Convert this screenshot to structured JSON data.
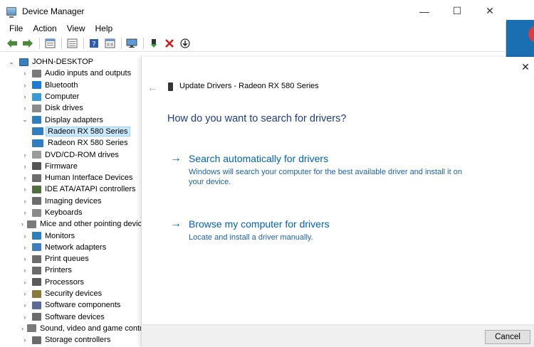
{
  "window": {
    "title": "Device Manager",
    "minimize_glyph": "—",
    "maximize_glyph": "☐",
    "close_glyph": "✕"
  },
  "menu": [
    "File",
    "Action",
    "View",
    "Help"
  ],
  "toolbar": [
    "back-icon",
    "forward-icon",
    "properties-icon",
    "console-icon",
    "help-icon",
    "view-icon",
    "monitor-icon",
    "update-driver-icon",
    "uninstall-icon",
    "download-icon"
  ],
  "tree": {
    "root": "JOHN-DESKTOP",
    "items": [
      {
        "label": "Audio inputs and outputs",
        "icon": "speaker-icon",
        "color": "#7a7a7a",
        "expanded": false
      },
      {
        "label": "Bluetooth",
        "icon": "bluetooth-icon",
        "color": "#1c7cd5",
        "expanded": false
      },
      {
        "label": "Computer",
        "icon": "computer-icon",
        "color": "#3a9ad9",
        "expanded": false
      },
      {
        "label": "Disk drives",
        "icon": "disk-icon",
        "color": "#8a8a8a",
        "expanded": false
      },
      {
        "label": "Display adapters",
        "icon": "display-icon",
        "color": "#2d7fc1",
        "expanded": true,
        "children": [
          {
            "label": "Radeon RX 580 Series",
            "selected": true
          },
          {
            "label": "Radeon RX 580 Series",
            "selected": false
          }
        ]
      },
      {
        "label": "DVD/CD-ROM drives",
        "icon": "dvd-icon",
        "color": "#9a9a9a",
        "expanded": false
      },
      {
        "label": "Firmware",
        "icon": "firmware-icon",
        "color": "#555555",
        "expanded": false
      },
      {
        "label": "Human Interface Devices",
        "icon": "hid-icon",
        "color": "#6b6b6b",
        "expanded": false
      },
      {
        "label": "IDE ATA/ATAPI controllers",
        "icon": "ide-icon",
        "color": "#4f6f3f",
        "expanded": false
      },
      {
        "label": "Imaging devices",
        "icon": "camera-icon",
        "color": "#6b6b6b",
        "expanded": false
      },
      {
        "label": "Keyboards",
        "icon": "keyboard-icon",
        "color": "#8a8a8a",
        "expanded": false
      },
      {
        "label": "Mice and other pointing devices",
        "icon": "mouse-icon",
        "color": "#7a7a7a",
        "expanded": false
      },
      {
        "label": "Monitors",
        "icon": "monitor-icon",
        "color": "#2d7fc1",
        "expanded": false
      },
      {
        "label": "Network adapters",
        "icon": "network-icon",
        "color": "#3a7fc1",
        "expanded": false
      },
      {
        "label": "Print queues",
        "icon": "print-queue-icon",
        "color": "#6b6b6b",
        "expanded": false
      },
      {
        "label": "Printers",
        "icon": "printer-icon",
        "color": "#6b6b6b",
        "expanded": false
      },
      {
        "label": "Processors",
        "icon": "processor-icon",
        "color": "#5a5a5a",
        "expanded": false
      },
      {
        "label": "Security devices",
        "icon": "security-icon",
        "color": "#8a7a3a",
        "expanded": false
      },
      {
        "label": "Software components",
        "icon": "software-component-icon",
        "color": "#5a6a9a",
        "expanded": false
      },
      {
        "label": "Software devices",
        "icon": "software-device-icon",
        "color": "#6b6b6b",
        "expanded": false
      },
      {
        "label": "Sound, video and game controllers",
        "icon": "sound-icon",
        "color": "#7a7a7a",
        "expanded": false
      },
      {
        "label": "Storage controllers",
        "icon": "storage-icon",
        "color": "#6b6b6b",
        "expanded": false
      }
    ]
  },
  "dialog": {
    "title": "Update Drivers - Radeon RX 580 Series",
    "question": "How do you want to search for drivers?",
    "options": [
      {
        "heading": "Search automatically for drivers",
        "description": "Windows will search your computer for the best available driver and install it on your device."
      },
      {
        "heading": "Browse my computer for drivers",
        "description": "Locate and install a driver manually."
      }
    ],
    "cancel": "Cancel",
    "close_glyph": "✕",
    "back_glyph": "←"
  }
}
